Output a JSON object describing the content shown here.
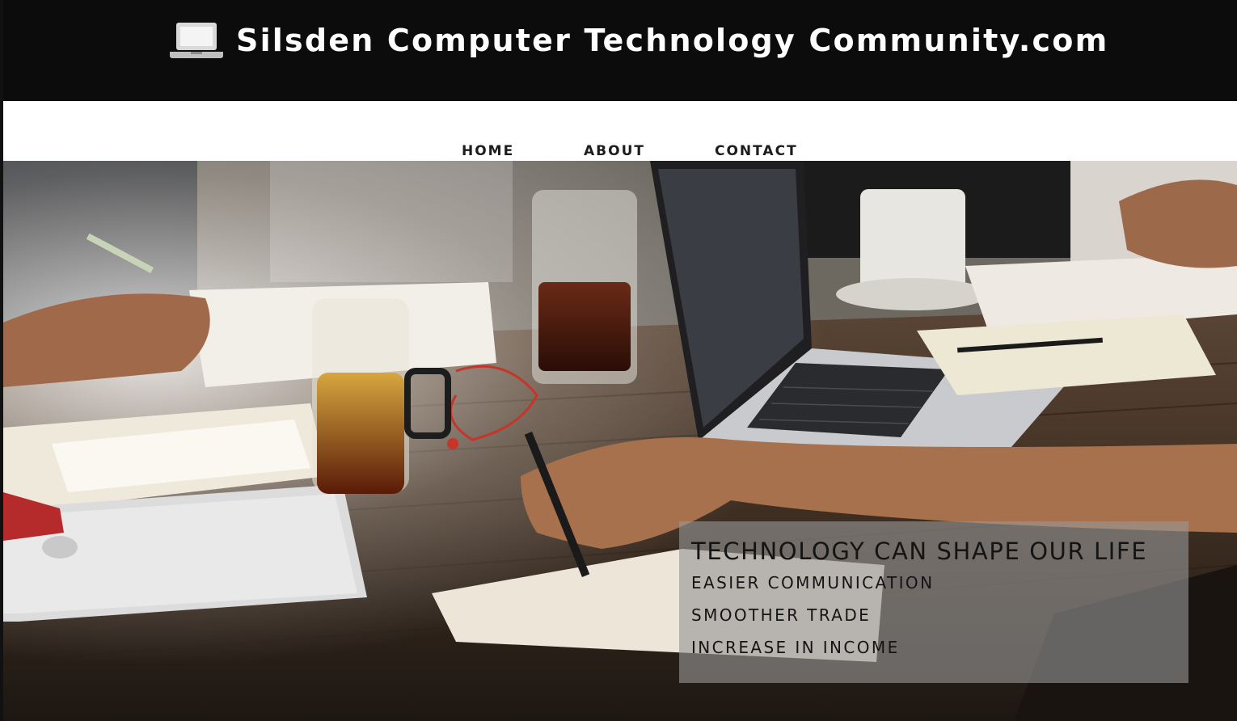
{
  "header": {
    "icon": "laptop-icon",
    "title": "Silsden Computer Technology Community.com",
    "background": "#0c0c0c"
  },
  "nav": {
    "items": [
      {
        "label": "HOME"
      },
      {
        "label": "ABOUT"
      },
      {
        "label": "CONTACT"
      }
    ]
  },
  "hero": {
    "caption": {
      "title": "TECHNOLOGY CAN SHAPE OUR LIFE",
      "lines": [
        "EASIER COMMUNICATION",
        "SMOOTHER TRADE",
        "INCREASE IN INCOME"
      ]
    }
  }
}
